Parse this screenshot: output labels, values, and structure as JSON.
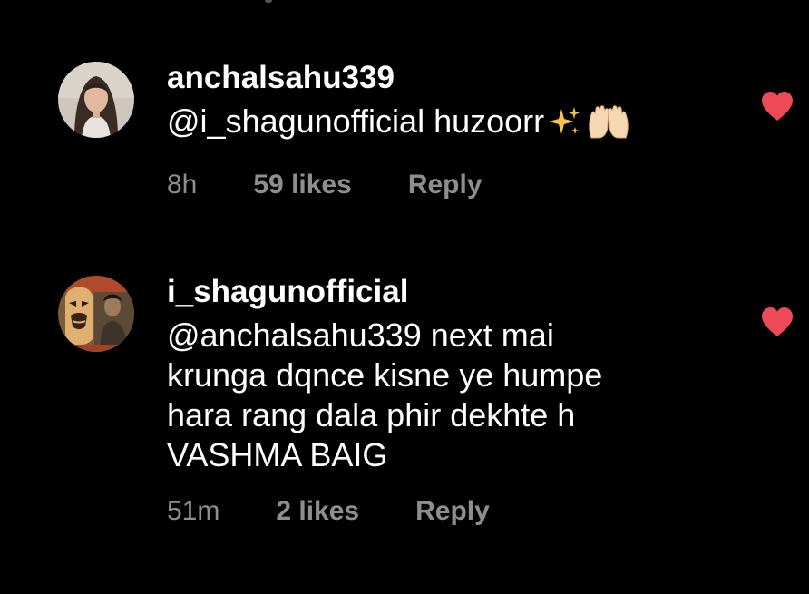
{
  "comments": [
    {
      "username": "anchalsahu339",
      "text": "@i_shagunofficial huzoorr",
      "emoji": [
        "sparkles-emoji",
        "raised-hands-emoji"
      ],
      "time": "8h",
      "likes": "59 likes",
      "reply_label": "Reply",
      "liked": true
    },
    {
      "username": "i_shagunofficial",
      "text": "@anchalsahu339 next mai\nkrunga dqnce kisne ye humpe\nhara rang dala phir dekhte h\nVASHMA BAIG",
      "time": "51m",
      "likes": "2 likes",
      "reply_label": "Reply",
      "liked": true
    }
  ],
  "colors": {
    "background": "#000000",
    "text": "#ffffff",
    "meta": "#8e8e8e",
    "heart": "#ed4956"
  },
  "icons": {
    "like": "heart-icon",
    "avatar_1": "avatar-photo-woman",
    "avatar_2": "avatar-photo-mask"
  }
}
